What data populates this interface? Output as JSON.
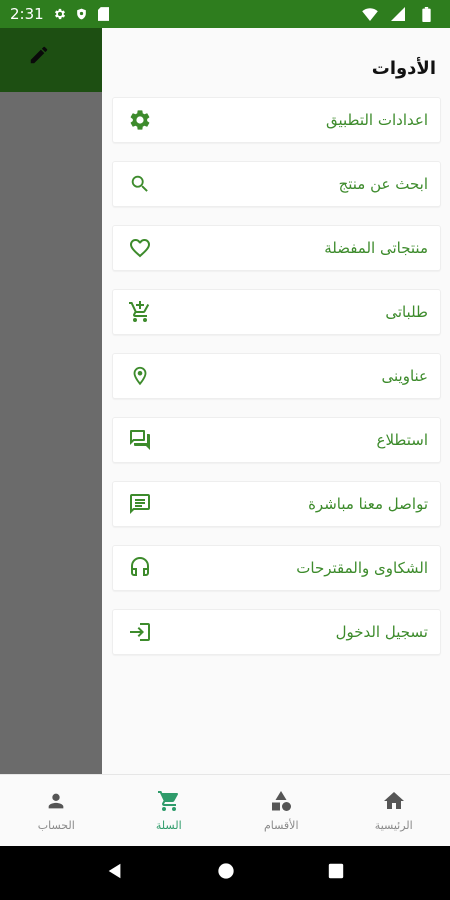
{
  "status_bar": {
    "time": "2:31",
    "icons": [
      "settings-icon",
      "shield-icon",
      "sim-icon",
      "wifi-icon",
      "signal-icon",
      "battery-icon"
    ]
  },
  "toolbar": {
    "edit_icon": "pencil-icon"
  },
  "drawer": {
    "title": "الأدوات",
    "items": [
      {
        "label": "اعدادات التطبيق",
        "icon": "gear-icon"
      },
      {
        "label": "ابحث عن منتج",
        "icon": "search-icon"
      },
      {
        "label": "منتجاتى المفضلة",
        "icon": "heart-icon"
      },
      {
        "label": "طلباتى",
        "icon": "add-cart-icon"
      },
      {
        "label": "عناوينى",
        "icon": "location-pin-icon"
      },
      {
        "label": "استطلاع",
        "icon": "forum-icon"
      },
      {
        "label": "تواصل معنا مباشرة",
        "icon": "chat-icon"
      },
      {
        "label": "الشكاوى والمقترحات",
        "icon": "headset-icon"
      },
      {
        "label": "تسجيل الدخول",
        "icon": "login-icon"
      }
    ]
  },
  "bottom_nav": {
    "items": [
      {
        "label": "الحساب",
        "icon": "person-icon",
        "active": false
      },
      {
        "label": "السلة",
        "icon": "cart-icon",
        "active": true
      },
      {
        "label": "الأقسام",
        "icon": "categories-icon",
        "active": false
      },
      {
        "label": "الرئيسية",
        "icon": "home-icon",
        "active": false
      }
    ]
  },
  "colors": {
    "status_bar": "#2e7d1e",
    "toolbar_dark": "#1d4f12",
    "accent_green": "#3d8b2c",
    "nav_active": "#2e9b6a",
    "nav_inactive": "#8a8a8a"
  }
}
